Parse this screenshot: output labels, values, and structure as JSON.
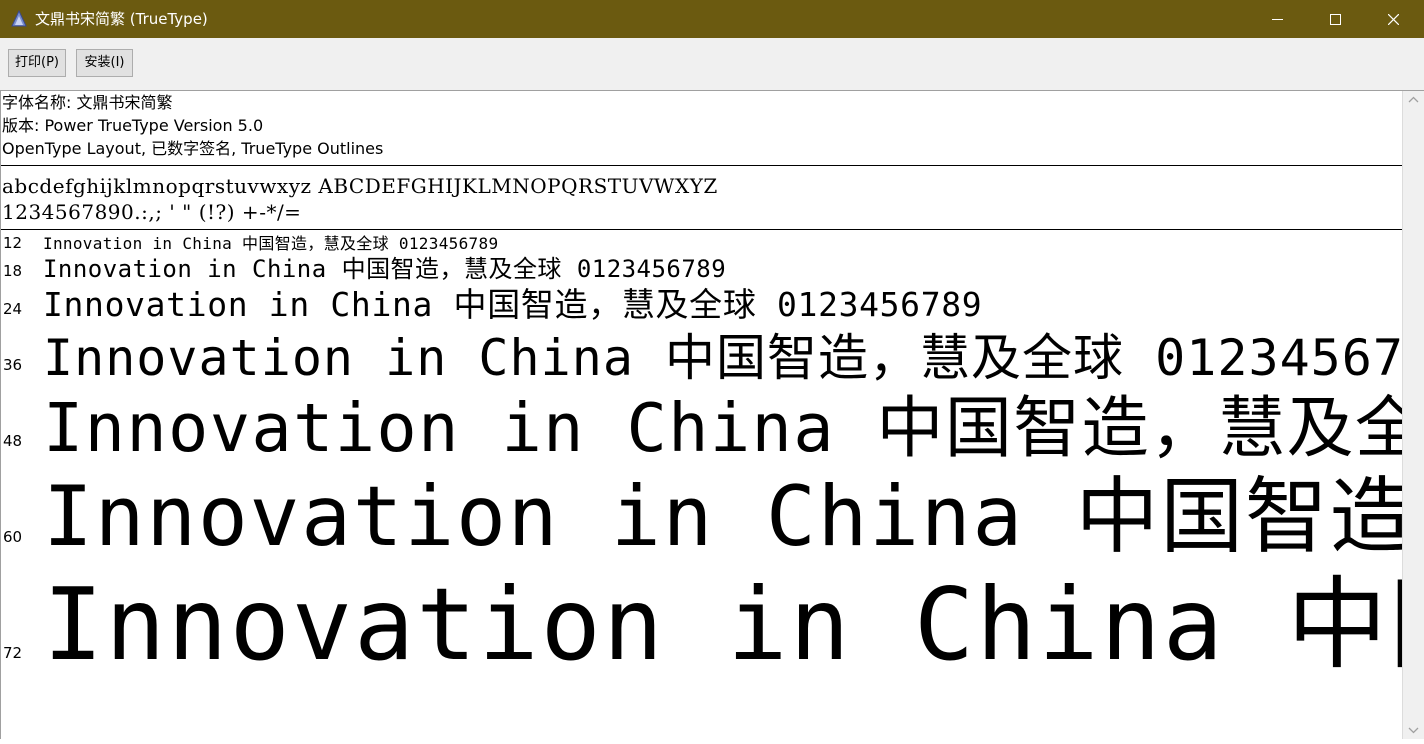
{
  "window": {
    "title": "文鼎书宋简繁 (TrueType)",
    "icon": "font-viewer-icon",
    "title_bar_color": "#6b5a10"
  },
  "toolbar": {
    "print_label": "打印(P)",
    "install_label": "安装(I)"
  },
  "font_info": {
    "name_line": "字体名称: 文鼎书宋简繁",
    "version_line": "版本: Power TrueType Version 5.0",
    "features_line": "OpenType Layout, 已数字签名, TrueType Outlines"
  },
  "charset": {
    "line1": "abcdefghijklmnopqrstuvwxyz ABCDEFGHIJKLMNOPQRSTUVWXYZ",
    "line2": "1234567890.:,; ' \" (!?) +-*/="
  },
  "samples": {
    "text": "Innovation in China 中国智造，慧及全球 0123456789",
    "rows": [
      {
        "size": "12"
      },
      {
        "size": "18"
      },
      {
        "size": "24"
      },
      {
        "size": "36"
      },
      {
        "size": "48"
      },
      {
        "size": "60"
      },
      {
        "size": "72"
      }
    ]
  }
}
